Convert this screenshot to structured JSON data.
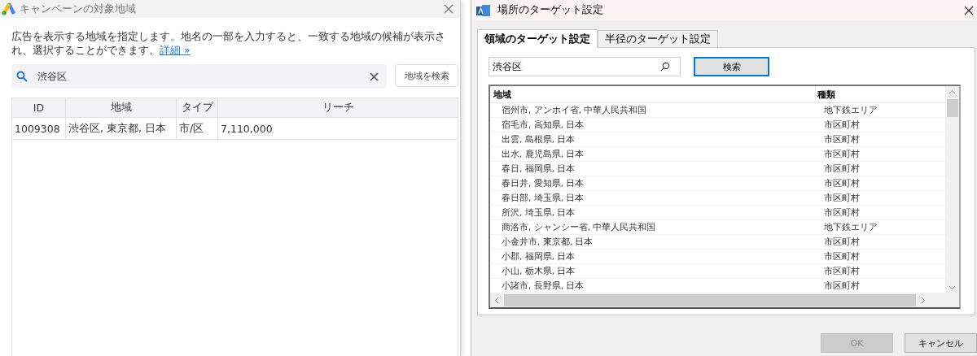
{
  "left_dialog": {
    "title": "キャンペーンの対象地域",
    "description": "広告を表示する地域を指定します。地名の一部を入力すると、一致する地域の候補が表示され、選択することができます。",
    "details_link": "詳細 »",
    "search": {
      "value": "渋谷区"
    },
    "search_button": "地域を検索",
    "table": {
      "columns": [
        "ID",
        "地域",
        "タイプ",
        "リーチ"
      ],
      "rows": [
        [
          "1009308",
          "渋谷区, 東京都, 日本",
          "市/区",
          "7,110,000"
        ]
      ]
    }
  },
  "right_dialog": {
    "title": "場所のターゲット設定",
    "tabs": [
      {
        "label": "領域のターゲット設定",
        "selected": true
      },
      {
        "label": "半径のターゲット設定",
        "selected": false
      }
    ],
    "search": {
      "value": "渋谷区"
    },
    "search_button": "検索",
    "list": {
      "columns": [
        "地域",
        "種類"
      ],
      "rows": [
        [
          "宿州市, アンホイ省, 中華人民共和国",
          "地下鉄エリア"
        ],
        [
          "宿毛市, 高知県, 日本",
          "市区町村"
        ],
        [
          "出雲, 島根県, 日本",
          "市区町村"
        ],
        [
          "出水, 鹿児島県, 日本",
          "市区町村"
        ],
        [
          "春日, 福岡県, 日本",
          "市区町村"
        ],
        [
          "春日井, 愛知県, 日本",
          "市区町村"
        ],
        [
          "春日部, 埼玉県, 日本",
          "市区町村"
        ],
        [
          "所沢, 埼玉県, 日本",
          "市区町村"
        ],
        [
          "商洛市, シャンシー省, 中華人民共和国",
          "地下鉄エリア"
        ],
        [
          "小金井市, 東京都, 日本",
          "市区町村"
        ],
        [
          "小郡, 福岡県, 日本",
          "市区町村"
        ],
        [
          "小山, 栃木県, 日本",
          "市区町村"
        ],
        [
          "小諸市, 長野県, 日本",
          "市区町村"
        ]
      ]
    },
    "buttons": [
      {
        "label": "OK",
        "disabled": true
      },
      {
        "label": "キャンセル",
        "disabled": false
      }
    ]
  }
}
